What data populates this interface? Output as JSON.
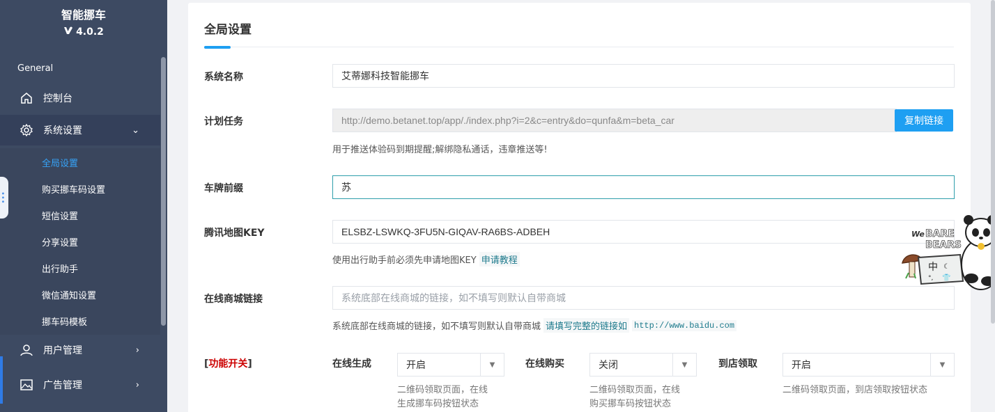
{
  "brand": {
    "title": "智能挪车",
    "version": "4.0.2"
  },
  "sidebar": {
    "section": "General",
    "items": [
      {
        "label": "控制台",
        "icon": "home-icon"
      },
      {
        "label": "系统设置",
        "icon": "gear-icon",
        "expanded": true
      },
      {
        "label": "用户管理",
        "icon": "user-icon"
      },
      {
        "label": "广告管理",
        "icon": "image-icon"
      }
    ],
    "subitems": [
      "全局设置",
      "购买挪车码设置",
      "短信设置",
      "分享设置",
      "出行助手",
      "微信通知设置",
      "挪车码模板"
    ],
    "current_sub": "全局设置"
  },
  "card": {
    "title": "全局设置"
  },
  "form": {
    "system_name": {
      "label": "系统名称",
      "value": "艾蒂娜科技智能挪车"
    },
    "cron": {
      "label": "计划任务",
      "value": "http://demo.betanet.top/app/./index.php?i=2&c=entry&do=qunfa&m=beta_car",
      "button": "复制链接",
      "help": "用于推送体验码到期提醒;解绑隐私通话，违章推送等!"
    },
    "plate_prefix": {
      "label": "车牌前缀",
      "value": "苏"
    },
    "map_key": {
      "label": "腾讯地图KEY",
      "value": "ELSBZ-LSWKQ-3FU5N-GIQAV-RA6BS-ADBEH",
      "help": "使用出行助手前必须先申请地图KEY",
      "help_link": "申请教程"
    },
    "shop_link": {
      "label": "在线商城链接",
      "placeholder": "系统底部在线商城的链接，如不填写则默认自带商城",
      "help": "系统底部在线商城的链接，如不填写则默认自带商城",
      "help_link": "请填写完整的链接如",
      "help_code": "http://www.baidu.com"
    },
    "switches": {
      "label_open": "[",
      "label_text": "功能开关",
      "label_close": "]",
      "items": [
        {
          "title": "在线生成",
          "value": "开启",
          "help_line1": "二维码领取页面，在线",
          "help_line2": "生成挪车码按钮状态"
        },
        {
          "title": "在线购买",
          "value": "关闭",
          "help_line1": "二维码领取页面，在线",
          "help_line2": "购买挪车码按钮状态"
        },
        {
          "title": "到店领取",
          "value": "开启",
          "help_line1": "二维码领取页面，到店领取按钮状态",
          "help_line2": ""
        }
      ]
    }
  },
  "colors": {
    "sidebar": "#3d4a62",
    "accent": "#1e9ff2",
    "active_sub": "#36a3f7",
    "switch_label": "#cc0000"
  }
}
